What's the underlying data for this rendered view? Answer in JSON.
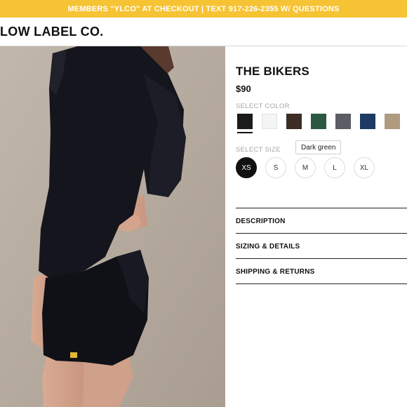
{
  "promo": {
    "text": "MEMBERS \"YLCO\" AT CHECKOUT | TEXT 917-226-2355 W/ QUESTIONS",
    "color": "#f6c334"
  },
  "header": {
    "logo": "LOW LABEL CO."
  },
  "product": {
    "title": "THE BIKERS",
    "price": "$90",
    "color_label": "SELECT COLOR",
    "size_label": "SELECT SIZE",
    "tooltip": "Dark green",
    "colors": [
      {
        "name": "Black",
        "hex": "#1b1b1b",
        "selected": true
      },
      {
        "name": "White",
        "hex": "#f4f4f4"
      },
      {
        "name": "Brown",
        "hex": "#3b2c26"
      },
      {
        "name": "Dark green",
        "hex": "#2c5843"
      },
      {
        "name": "Grey",
        "hex": "#5a5d63"
      },
      {
        "name": "Navy",
        "hex": "#1d3a64"
      },
      {
        "name": "Tan",
        "hex": "#b09a80"
      }
    ],
    "sizes": [
      {
        "label": "XS",
        "selected": true
      },
      {
        "label": "S"
      },
      {
        "label": "M"
      },
      {
        "label": "L"
      },
      {
        "label": "XL"
      }
    ],
    "accordion": [
      "DESCRIPTION",
      "SIZING & DETAILS",
      "SHIPPING & RETURNS"
    ]
  }
}
